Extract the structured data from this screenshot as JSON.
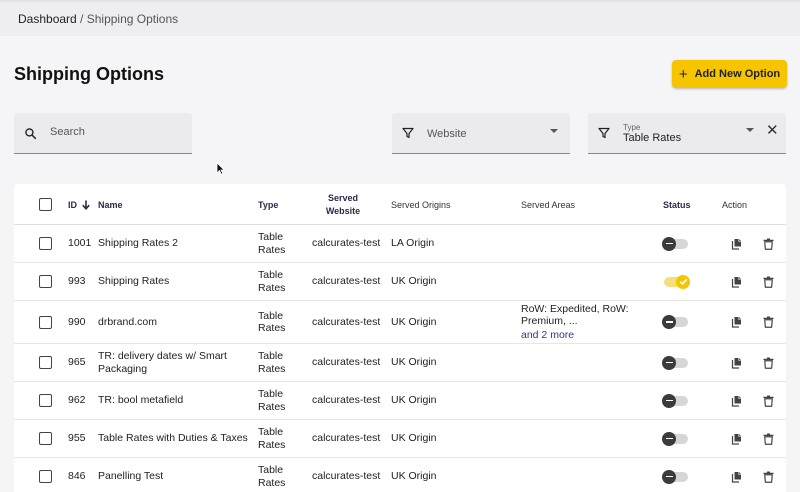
{
  "breadcrumb": {
    "root": "Dashboard",
    "separator": " / ",
    "current": "Shipping Options"
  },
  "page": {
    "title": "Shipping Options",
    "add_button": "Add New Option"
  },
  "filters": {
    "search_label": "Search",
    "website_label": "Website",
    "type_label": "Type",
    "type_value": "Table Rates"
  },
  "table": {
    "headers": {
      "id": "ID",
      "name": "Name",
      "type": "Type",
      "served_website_1": "Served",
      "served_website_2": "Website",
      "served_origins": "Served Origins",
      "served_areas": "Served Areas",
      "status": "Status",
      "action": "Action"
    },
    "rows": [
      {
        "id": "1001",
        "name": "Shipping Rates 2",
        "type_1": "Table",
        "type_2": "Rates",
        "website": "calcurates-test",
        "origin": "LA Origin",
        "areas": "",
        "areas_more": "",
        "status": "off"
      },
      {
        "id": "993",
        "name": "Shipping Rates",
        "type_1": "Table",
        "type_2": "Rates",
        "website": "calcurates-test",
        "origin": "UK Origin",
        "areas": "",
        "areas_more": "",
        "status": "on"
      },
      {
        "id": "990",
        "name": "drbrand.com",
        "type_1": "Table",
        "type_2": "Rates",
        "website": "calcurates-test",
        "origin": "UK Origin",
        "areas": "RoW: Expedited, RoW: Premium, ...",
        "areas_more": "and 2 more",
        "status": "off"
      },
      {
        "id": "965",
        "name": "TR: delivery dates w/ Smart Packaging",
        "type_1": "Table",
        "type_2": "Rates",
        "website": "calcurates-test",
        "origin": "UK Origin",
        "areas": "",
        "areas_more": "",
        "status": "off"
      },
      {
        "id": "962",
        "name": "TR: bool metafield",
        "type_1": "Table",
        "type_2": "Rates",
        "website": "calcurates-test",
        "origin": "UK Origin",
        "areas": "",
        "areas_more": "",
        "status": "off"
      },
      {
        "id": "955",
        "name": "Table Rates with Duties & Taxes",
        "type_1": "Table",
        "type_2": "Rates",
        "website": "calcurates-test",
        "origin": "UK Origin",
        "areas": "",
        "areas_more": "",
        "status": "off"
      },
      {
        "id": "846",
        "name": "Panelling Test",
        "type_1": "Table",
        "type_2": "Rates",
        "website": "calcurates-test",
        "origin": "UK Origin",
        "areas": "",
        "areas_more": "",
        "status": "off"
      }
    ]
  },
  "colors": {
    "accent": "#f7c500",
    "link": "#2b3a8c",
    "background": "#f5f4f6"
  },
  "icons": {
    "search": "search-icon",
    "filter": "filter-icon",
    "clear": "close-icon",
    "sort": "arrow-down-icon",
    "duplicate": "copy-icon",
    "delete": "trash-icon"
  }
}
